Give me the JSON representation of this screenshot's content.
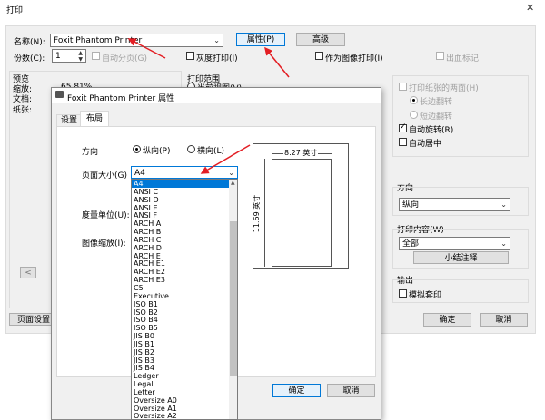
{
  "print_dialog": {
    "title": "打印",
    "close": "✕",
    "name_label": "名称(N):",
    "printer": "Foxit Phantom Printer",
    "properties": "属性(P)",
    "advanced": "高级",
    "copies_label": "份数(C):",
    "copies": "1",
    "auto_pages": "自动分页(G)",
    "grayscale": "灰度打印(I)",
    "as_image": "作为图像打印(I)",
    "out_mark": "出血标记",
    "preview": "预览",
    "zoom_label": "缩放:",
    "zoom": "65.81%",
    "doc_label": "文档:",
    "paper_label": "纸张:",
    "range_title": "打印范围",
    "current_view": "当前视图(V)",
    "duplex": "打印纸张的两面(H)",
    "long_edge": "长边翻转",
    "short_edge": "短边翻转",
    "auto_rotate": "自动旋转(R)",
    "auto_center": "自动居中",
    "orient_title": "方向",
    "orient_value": "纵向",
    "content_title": "打印内容(W)",
    "content_value": "全部",
    "summary": "小结注释",
    "output_title": "输出",
    "simulate": "模拟套印",
    "ok": "确定",
    "cancel": "取消",
    "page_setup": "页面设置",
    "prev": "<"
  },
  "props_dialog": {
    "title": "Foxit Phantom Printer 属性",
    "tabs": [
      "设置",
      "布局"
    ],
    "orientation_label": "方向",
    "portrait": "纵向(P)",
    "landscape": "横向(L)",
    "paper_size_label": "页面大小(G)",
    "paper_size": "A4",
    "unit_label": "度量单位(U):",
    "scale_label": "图像缩放(I):",
    "width_label": "8.27 英寸",
    "height_label": "11.69 英寸",
    "ok": "确定",
    "cancel": "取消",
    "paper_options": [
      "A4",
      "ANSI C",
      "ANSI D",
      "ANSI E",
      "ANSI F",
      "ARCH A",
      "ARCH B",
      "ARCH C",
      "ARCH D",
      "ARCH E",
      "ARCH E1",
      "ARCH E2",
      "ARCH E3",
      "C5",
      "Executive",
      "ISO B1",
      "ISO B2",
      "ISO B4",
      "ISO B5",
      "JIS B0",
      "JIS B1",
      "JIS B2",
      "JIS B3",
      "JIS B4",
      "Ledger",
      "Legal",
      "Letter",
      "Oversize A0",
      "Oversize A1",
      "Oversize A2"
    ]
  },
  "colors": {
    "accent": "#0078d7",
    "arrow": "#e31e24"
  }
}
